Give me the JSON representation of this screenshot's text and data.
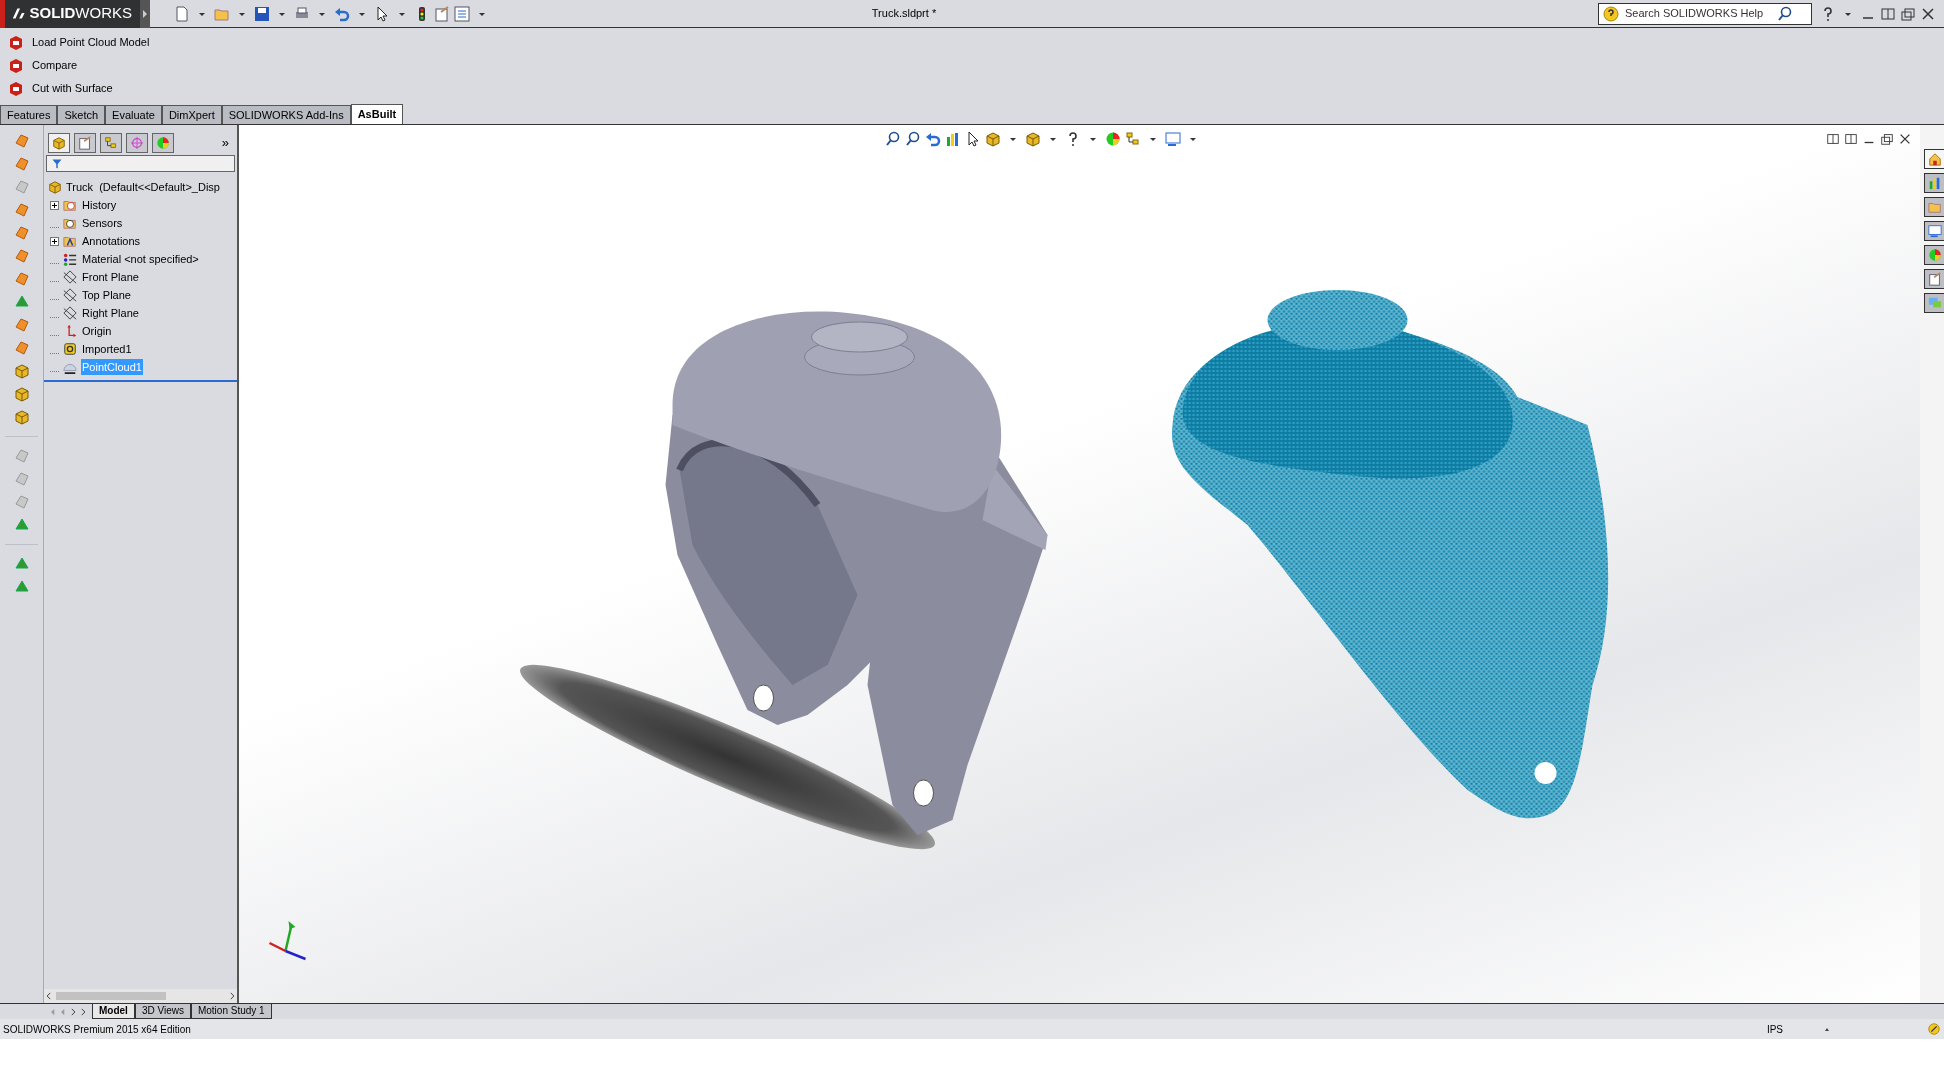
{
  "window": {
    "title": "Truck.sldprt *",
    "logo": "**SOLID**WORKS"
  },
  "search": {
    "placeholder": "Search SOLIDWORKS Help"
  },
  "commands": [
    {
      "label": "Load Point Cloud Model"
    },
    {
      "label": "Compare"
    },
    {
      "label": "Cut with Surface"
    }
  ],
  "command_tabs": [
    {
      "label": "Features",
      "selected": false
    },
    {
      "label": "Sketch",
      "selected": false
    },
    {
      "label": "Evaluate",
      "selected": false
    },
    {
      "label": "DimXpert",
      "selected": false
    },
    {
      "label": "SOLIDWORKS Add-Ins",
      "selected": false
    },
    {
      "label": "AsBuilt",
      "selected": true
    }
  ],
  "manager_tabs": [
    {
      "selected": true
    },
    {
      "selected": false
    },
    {
      "selected": false
    },
    {
      "selected": false
    },
    {
      "selected": false
    }
  ],
  "manager_more": "»",
  "tree": {
    "root": "Truck  (Default<<Default>_Disp",
    "items": [
      {
        "label": "History",
        "kind": "history",
        "has_children": true,
        "selected": false
      },
      {
        "label": "Sensors",
        "kind": "sensors",
        "has_children": false,
        "selected": false
      },
      {
        "label": "Annotations",
        "kind": "annotations",
        "has_children": true,
        "selected": false
      },
      {
        "label": "Material <not specified>",
        "kind": "material",
        "has_children": false,
        "selected": false
      },
      {
        "label": "Front Plane",
        "kind": "plane",
        "has_children": false,
        "selected": false
      },
      {
        "label": "Top Plane",
        "kind": "plane",
        "has_children": false,
        "selected": false
      },
      {
        "label": "Right Plane",
        "kind": "plane",
        "has_children": false,
        "selected": false
      },
      {
        "label": "Origin",
        "kind": "origin",
        "has_children": false,
        "selected": false
      },
      {
        "label": "Imported1",
        "kind": "imported",
        "has_children": false,
        "selected": false
      },
      {
        "label": "PointCloud1",
        "kind": "point_cloud",
        "has_children": false,
        "selected": true
      }
    ]
  },
  "task_pane": [
    {
      "selected": true
    },
    {
      "selected": false
    },
    {
      "selected": false
    },
    {
      "selected": false
    },
    {
      "selected": false
    },
    {
      "selected": false
    },
    {
      "selected": false
    }
  ],
  "bottom_tabs": [
    {
      "label": "Model",
      "selected": true
    },
    {
      "label": "3D Views",
      "selected": false
    },
    {
      "label": "Motion Study 1",
      "selected": false
    }
  ],
  "status_bar": {
    "text": "SOLIDWORKS Premium 2015 x64 Edition",
    "units": "IPS"
  }
}
